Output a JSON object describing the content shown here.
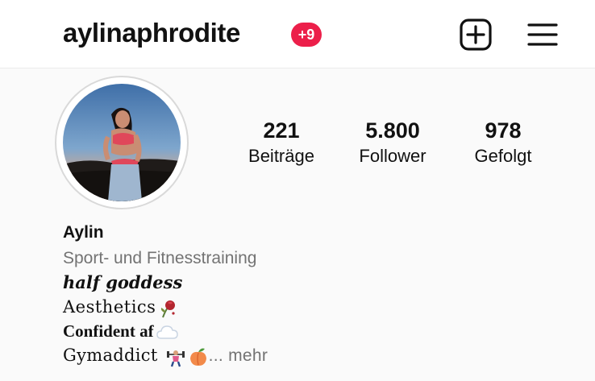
{
  "header": {
    "username": "aylinaphrodite",
    "notification_badge": "+9",
    "icons": [
      "add-post-icon",
      "menu-icon"
    ]
  },
  "profile": {
    "avatar": "profile-photo",
    "stats": [
      {
        "value": "221",
        "label": "Beiträge"
      },
      {
        "value": "5.800",
        "label": "Follower"
      },
      {
        "value": "978",
        "label": "Gefolgt"
      }
    ]
  },
  "bio": {
    "name": "Aylin",
    "category": "Sport- und Fitnesstraining",
    "lines": [
      "half goddess",
      "Aesthetics",
      "Confident af",
      "Gymaddict"
    ],
    "emojis": [
      "wilted-rose-emoji",
      "cloud-emoji",
      "weightlifter-emoji",
      "peach-emoji"
    ],
    "more_label": "... mehr"
  },
  "colors": {
    "badge": "#ec1f4a",
    "secondary_text": "#737373",
    "background": "#fafafa"
  }
}
